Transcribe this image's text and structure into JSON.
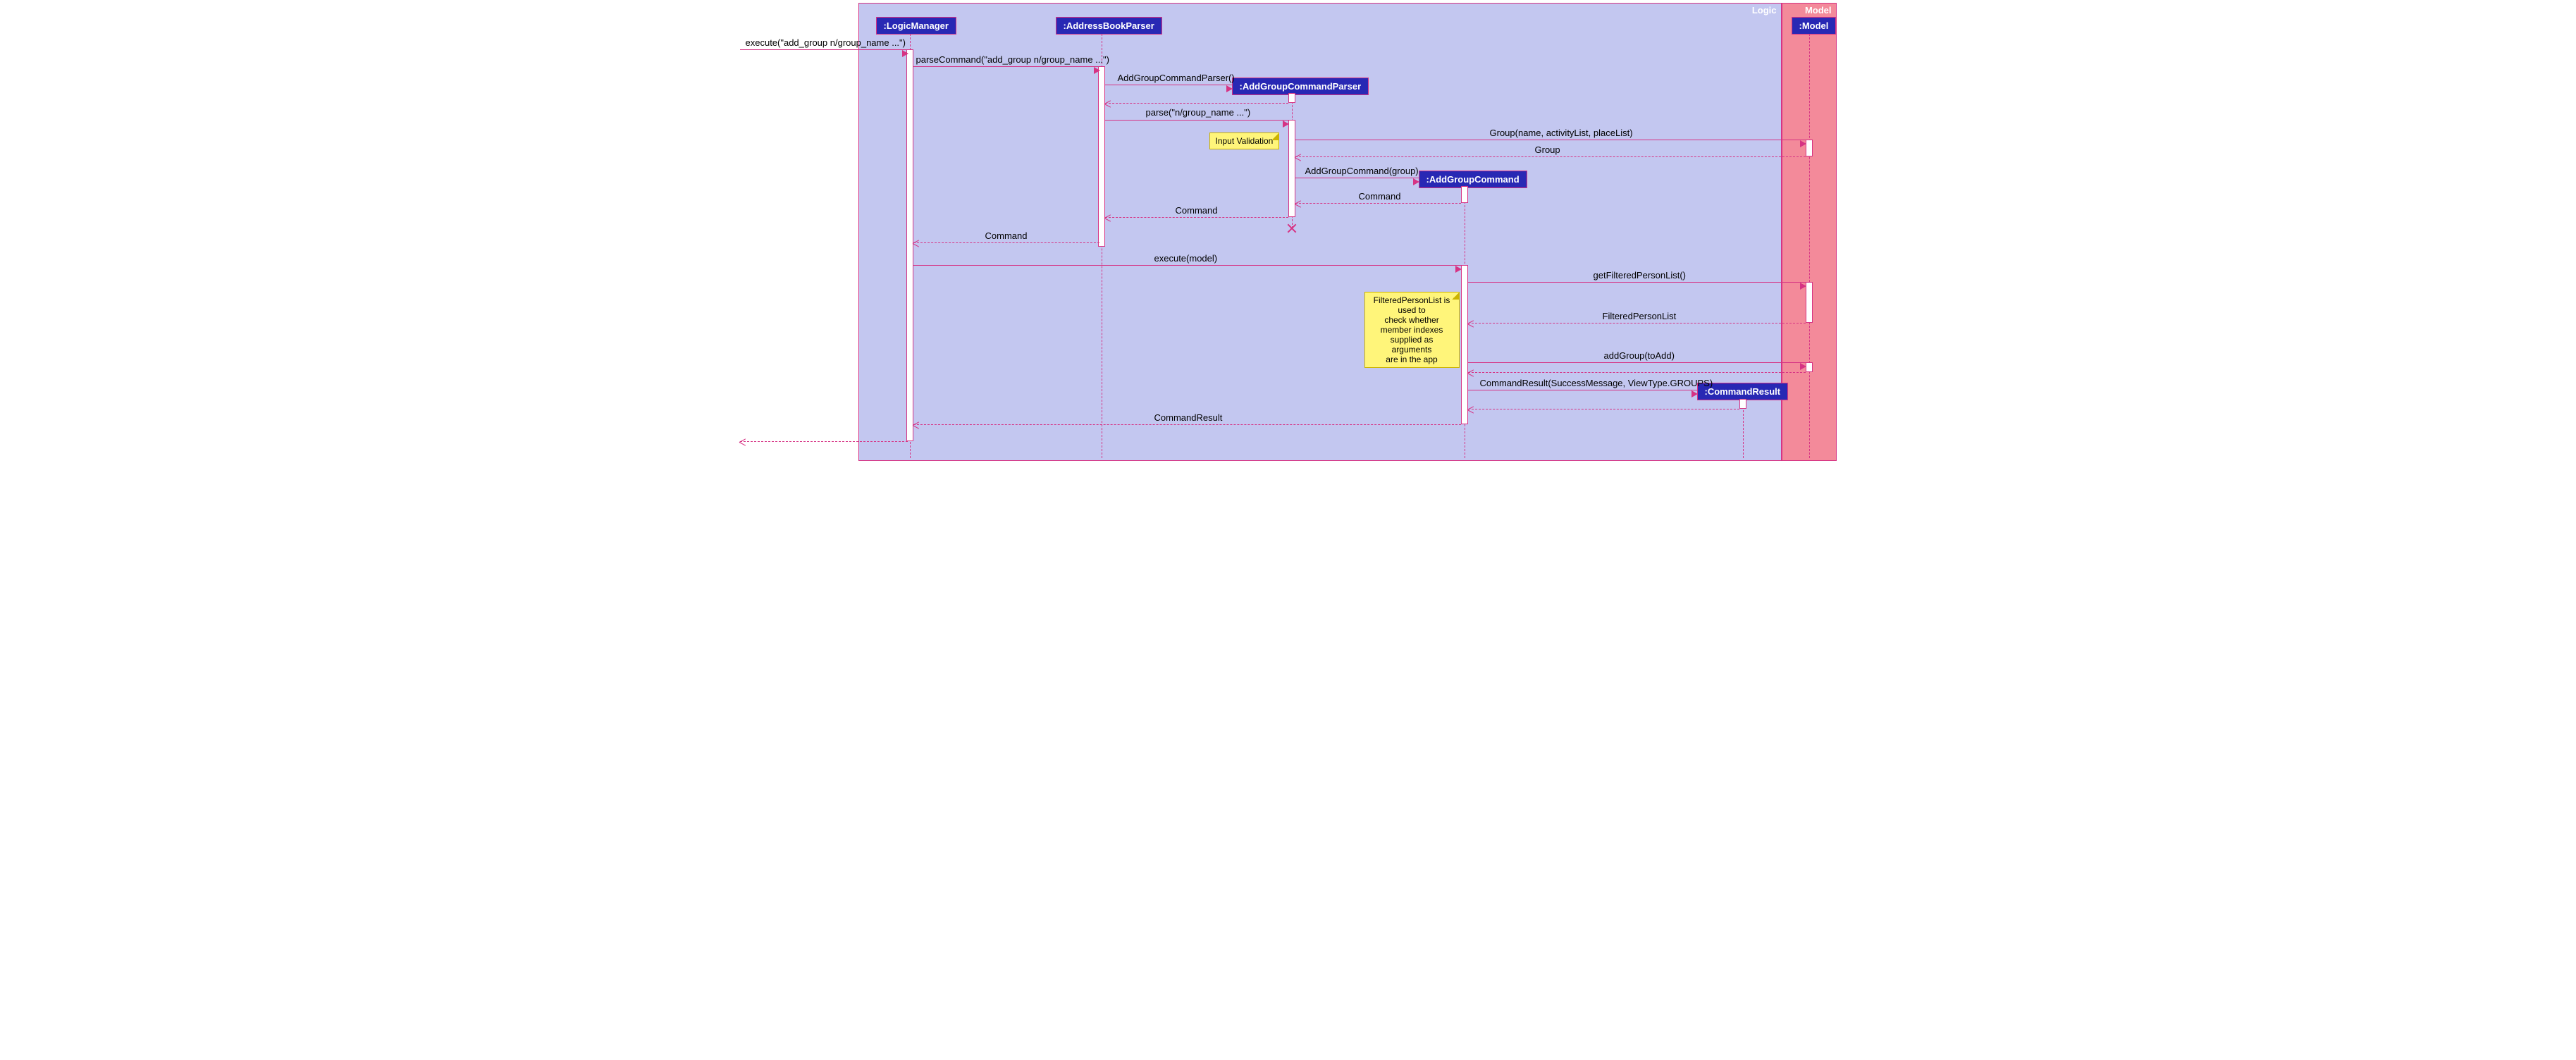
{
  "regions": {
    "logic": "Logic",
    "model": "Model"
  },
  "participants": {
    "logicManager": ":LogicManager",
    "addressBookParser": ":AddressBookParser",
    "addGroupCommandParser": ":AddGroupCommandParser",
    "addGroupCommand": ":AddGroupCommand",
    "commandResult": ":CommandResult",
    "model": ":Model"
  },
  "messages": {
    "execute": "execute(\"add_group n/group_name ...\")",
    "parseCommand": "parseCommand(\"add_group n/group_name ...\")",
    "newParser": "AddGroupCommandParser()",
    "parse": "parse(\"n/group_name ...\")",
    "groupCtor": "Group(name, activityList, placeList)",
    "groupReturn": "Group",
    "newCommand": "AddGroupCommand(group)",
    "commandReturn1": "Command",
    "commandReturn2": "Command",
    "commandReturn3": "Command",
    "executeModel": "execute(model)",
    "getFiltered": "getFilteredPersonList()",
    "filteredReturn": "FilteredPersonList",
    "addGroup": "addGroup(toAdd)",
    "newResult": "CommandResult(SuccessMessage, ViewType.GROUPS)",
    "resultReturn": "CommandResult"
  },
  "notes": {
    "inputValidation": "Input Validation",
    "filteredNote": "FilteredPersonList is\nused to\ncheck whether\nmember indexes\nsupplied as arguments\nare in the app"
  }
}
